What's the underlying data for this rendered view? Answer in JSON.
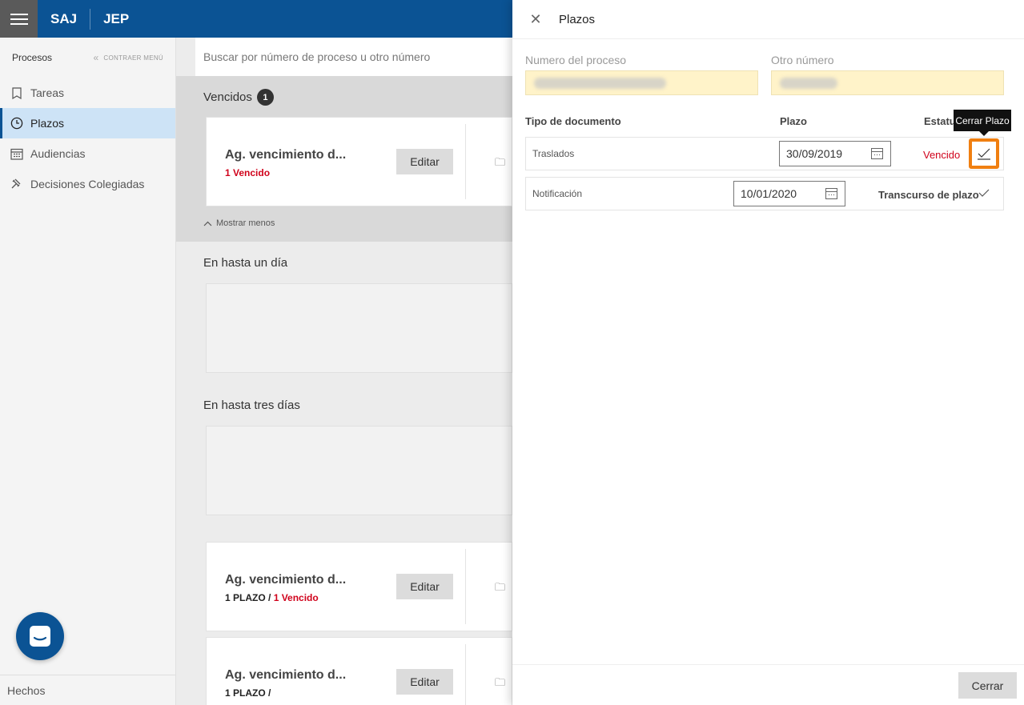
{
  "header": {
    "brand1": "SAJ",
    "brand2": "JEP"
  },
  "sidebar": {
    "title": "Procesos",
    "collapse_label": "CONTRAER MENÚ",
    "items": [
      {
        "label": "Tareas",
        "icon": "bookmark-icon",
        "active": false
      },
      {
        "label": "Plazos",
        "icon": "clock-icon",
        "active": true
      },
      {
        "label": "Audiencias",
        "icon": "calendar-icon",
        "active": false
      },
      {
        "label": "Decisiones Colegiadas",
        "icon": "gavel-icon",
        "active": false
      }
    ],
    "footer": "Hechos"
  },
  "search": {
    "placeholder": "Buscar por número de proceso u otro número"
  },
  "sections": {
    "vencidos": {
      "label": "Vencidos",
      "count": "1"
    },
    "mostrar_menos": "Mostrar menos",
    "hasta_un_dia": "En hasta un día",
    "hasta_tres_dias": "En hasta tres días"
  },
  "cards": [
    {
      "title": "Ag. vencimiento d...",
      "prefix": "",
      "status": "1 Vencido",
      "edit": "Editar"
    },
    {
      "title": "Ag. vencimiento d...",
      "prefix": "1 PLAZO / ",
      "status": "1 Vencido",
      "edit": "Editar"
    },
    {
      "title": "Ag. vencimiento d...",
      "prefix": "1 PLAZO /",
      "status": "",
      "edit": "Editar"
    }
  ],
  "panel": {
    "title": "Plazos",
    "fields": {
      "numero_label": "Numero del proceso",
      "otro_label": "Otro número"
    },
    "columns": {
      "tipo": "Tipo de documento",
      "plazo": "Plazo",
      "estatus": "Estatu"
    },
    "rows": [
      {
        "doc": "Traslados",
        "date": "30/09/2019",
        "status": "Vencido"
      },
      {
        "doc": "Notificación",
        "date": "10/01/2020",
        "status": "Transcurso de plazo"
      }
    ],
    "tooltip": "Cerrar Plazo",
    "close_button": "Cerrar"
  },
  "colors": {
    "primary": "#0b5394",
    "danger": "#d0021b",
    "highlight": "#f07f11",
    "field_bg": "#fff3c9"
  }
}
